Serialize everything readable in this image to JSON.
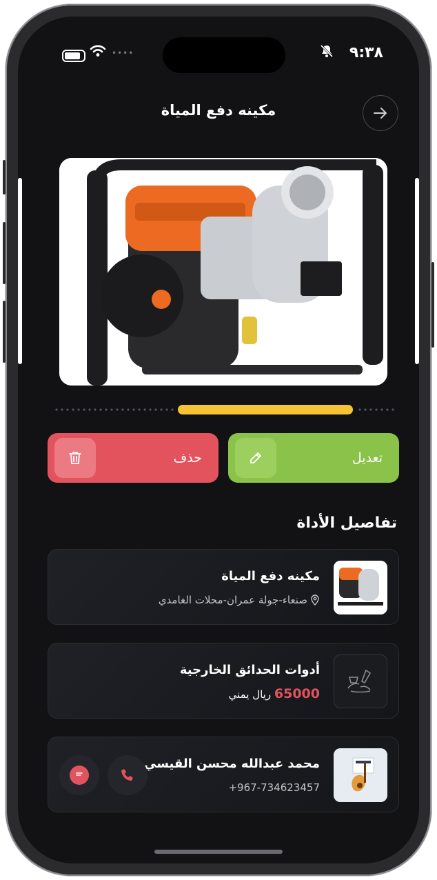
{
  "status_bar": {
    "time": "٩:٣٨"
  },
  "header": {
    "title": "مكينه دفع المياة"
  },
  "actions": {
    "edit_label": "تعديل",
    "delete_label": "حذف"
  },
  "details": {
    "section_title": "تفاصيل الأداة",
    "tool": {
      "name": "مكينه دفع المياة",
      "location": "صنعاء-جولة عمران-محلات الغامدي"
    },
    "category": {
      "name": "أدوات الحدائق الخارجية",
      "price": "65000",
      "currency": "ريال يمني"
    },
    "owner": {
      "name": "محمد عبدالله محسن القيسي",
      "phone": "+967-734623457"
    }
  },
  "carousel": {
    "slides_progress": 0.55
  },
  "colors": {
    "accent": "#f6c433",
    "edit": "#8bc34a",
    "delete": "#e2535e",
    "background": "#121214"
  },
  "icons": [
    "arrow-right-icon",
    "pencil-icon",
    "trash-icon",
    "location-pin-icon",
    "garden-tools-icon",
    "phone-icon",
    "chat-icon"
  ]
}
